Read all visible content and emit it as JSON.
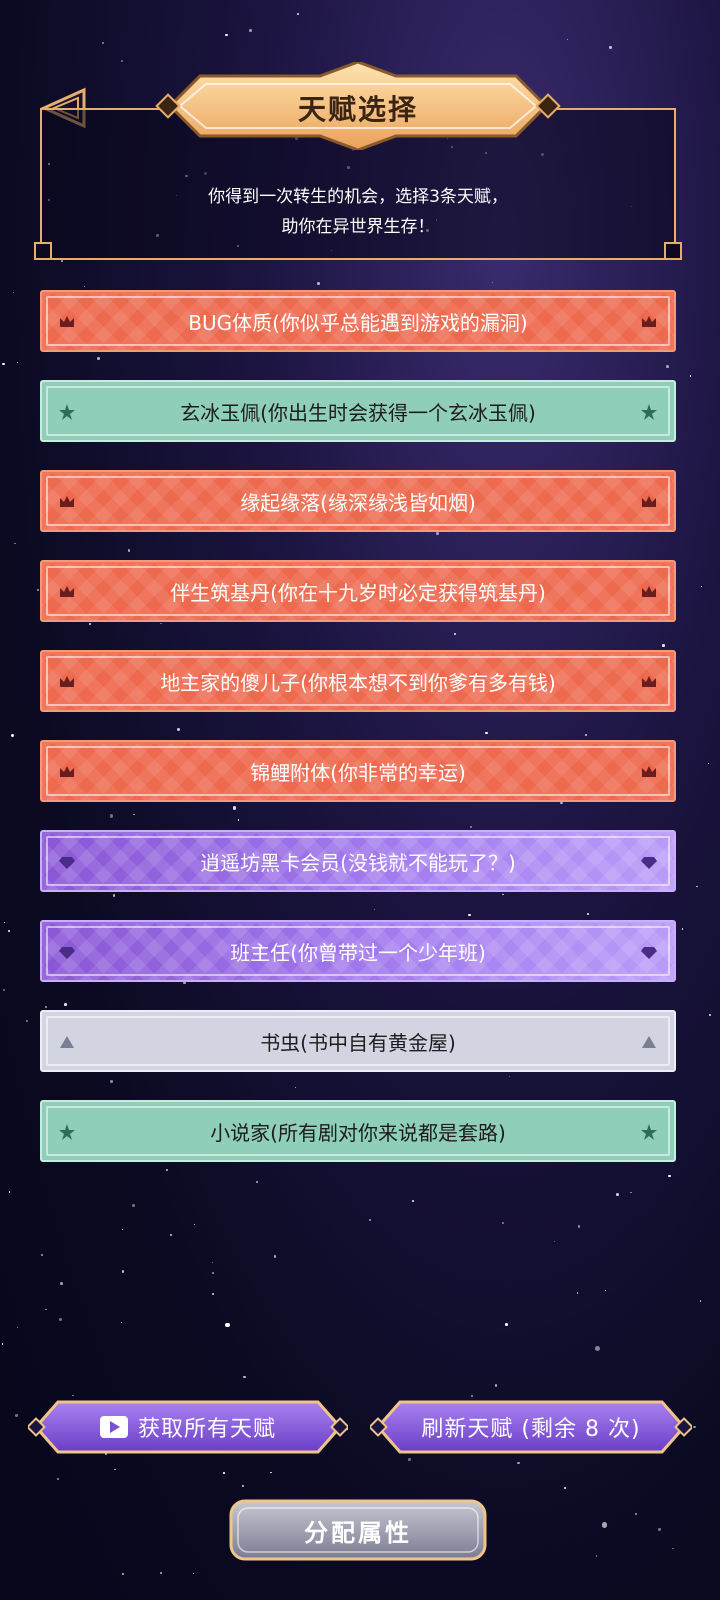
{
  "header": {
    "title": "天赋选择",
    "description": "你得到一次转生的机会，选择3条天赋，\n助你在异世界生存！"
  },
  "talents": [
    {
      "label": "BUG体质(你似乎总能遇到游戏的漏洞)",
      "tier": "red",
      "icon": "crown-icon"
    },
    {
      "label": "玄冰玉佩(你出生时会获得一个玄冰玉佩)",
      "tier": "green",
      "icon": "star-icon"
    },
    {
      "label": "缘起缘落(缘深缘浅皆如烟)",
      "tier": "red",
      "icon": "crown-icon"
    },
    {
      "label": "伴生筑基丹(你在十九岁时必定获得筑基丹)",
      "tier": "red",
      "icon": "crown-icon"
    },
    {
      "label": "地主家的傻儿子(你根本想不到你爹有多有钱)",
      "tier": "red",
      "icon": "crown-icon"
    },
    {
      "label": "锦鲤附体(你非常的幸运)",
      "tier": "red",
      "icon": "crown-icon"
    },
    {
      "label": "逍遥坊黑卡会员(没钱就不能玩了？)",
      "tier": "purple",
      "icon": "diamond-icon"
    },
    {
      "label": "班主任(你曾带过一个少年班)",
      "tier": "purple",
      "icon": "diamond-icon"
    },
    {
      "label": "书虫(书中自有黄金屋)",
      "tier": "silver",
      "icon": "triangle-icon"
    },
    {
      "label": "小说家(所有剧对你来说都是套路)",
      "tier": "green",
      "icon": "star-icon"
    }
  ],
  "buttons": {
    "get_all": "获取所有天赋",
    "refresh": "刷新天赋 (剩余 8 次)",
    "assign": "分配属性"
  },
  "colors": {
    "red": "#ee6a4f",
    "green": "#8fcfb9",
    "purple": "#9a6ee6",
    "silver": "#d3d4e2",
    "gold": "#f3b56b"
  }
}
